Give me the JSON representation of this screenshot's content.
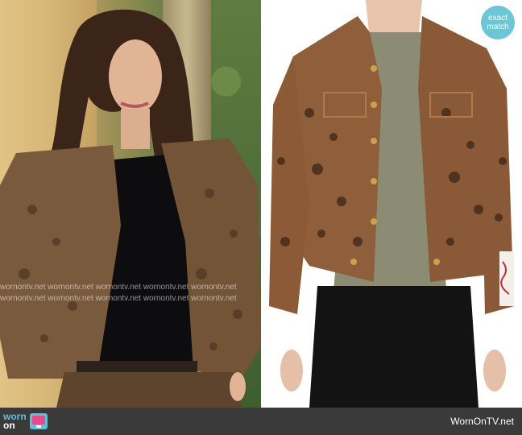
{
  "badge": {
    "line1": "exact",
    "line2": "match",
    "color": "#6cc6d6"
  },
  "watermark": {
    "text": "wornontv.net",
    "row1": "wornontv.net wornontv.net wornontv.net wornontv.net wornontv.net",
    "row2": "wornontv.net wornontv.net wornontv.net wornontv.net wornontv.net"
  },
  "footer": {
    "logo_top": "worn",
    "logo_bottom": "on",
    "site": "WornOnTV.net",
    "logo_color": "#5bc0d8"
  }
}
